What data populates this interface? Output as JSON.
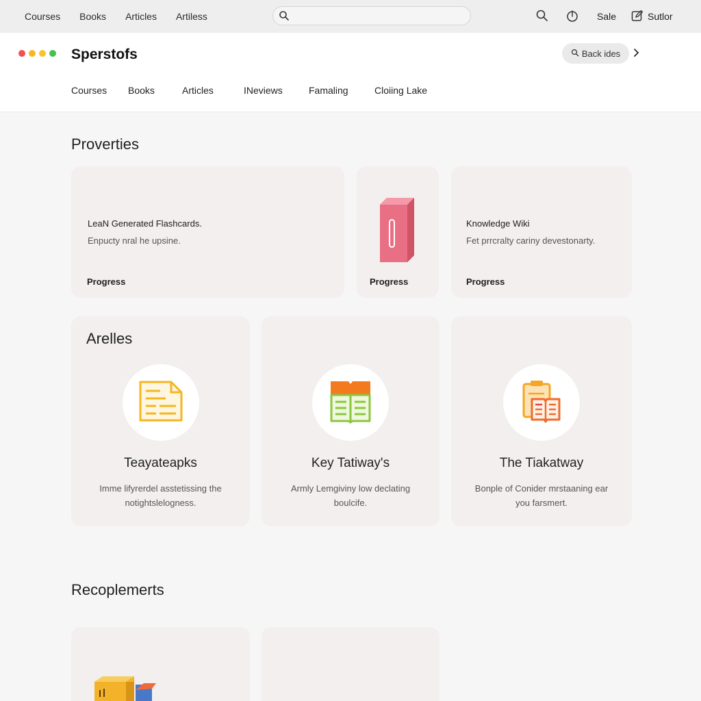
{
  "topbar": {
    "nav": [
      "Courses",
      "Books",
      "Articles",
      "Artiless"
    ],
    "search": {
      "placeholder": "",
      "icon": "search-icon"
    },
    "sale": "Sale",
    "sutor": "Sutlor"
  },
  "header": {
    "window_dots": [
      "#ef5350",
      "#f5c125",
      "#fbc02d",
      "#43c24a"
    ],
    "brand": "Sperstofs",
    "back_button": "Back ides",
    "subnav": [
      "Courses",
      "Books",
      "Articles",
      "INeviews",
      "Famaling",
      "Cloiing Lake"
    ]
  },
  "section1": {
    "title": "Proverties",
    "cards": [
      {
        "title": "LeaN Generated Flashcards.",
        "desc": "Enpucty nral he upsine.",
        "progress": "Progress"
      },
      {
        "title": "",
        "desc": "",
        "progress": "Progress",
        "icon": "book-icon"
      },
      {
        "title": "Knowledge Wiki",
        "desc": "Fet prrcralty cariny devestonarty.",
        "progress": "Progress"
      }
    ]
  },
  "section2": {
    "title": "Arelles",
    "cards": [
      {
        "icon": "document-icon",
        "title": "Teayateapks",
        "desc": "Imme lifyrerdel asstetissing the notightslelogness."
      },
      {
        "icon": "open-book-icon",
        "title": "Key Tatiway's",
        "desc": "Armly Lemgiviny low declating boulcife."
      },
      {
        "icon": "clipboard-book-icon",
        "title": "The Tiakatway",
        "desc": "Bonple of Conider mrstaaning ear you farsmert."
      }
    ]
  },
  "section3": {
    "title": "Recoplemerts"
  }
}
